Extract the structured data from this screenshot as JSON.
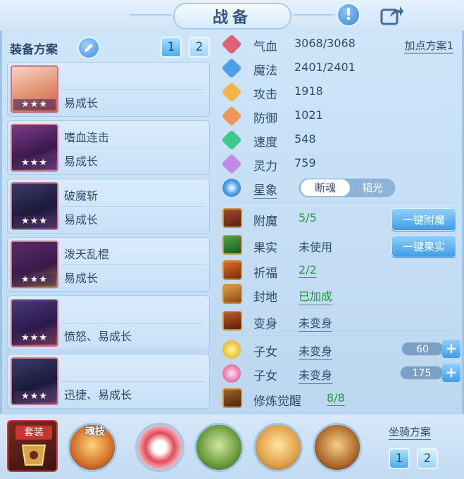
{
  "title": "战备",
  "icons": {
    "info": "exclamation-icon",
    "share": "share-arrow-icon",
    "edit": "pencil-icon"
  },
  "equipment_scheme": {
    "label": "装备方案",
    "tabs": [
      "1",
      "2"
    ],
    "items": [
      {
        "name": "",
        "trait": "易成长",
        "stars": "★★★"
      },
      {
        "name": "嗜血连击",
        "trait": "易成长",
        "stars": "★★★"
      },
      {
        "name": "破魔斩",
        "trait": "易成长",
        "stars": "★★★"
      },
      {
        "name": "泼天乱棍",
        "trait": "易成长",
        "stars": "★★★"
      },
      {
        "name": "",
        "trait": "愤怒、易成长",
        "stars": "★★★"
      },
      {
        "name": "",
        "trait": "迅捷、易成长",
        "stars": "★★★"
      }
    ]
  },
  "attributes": {
    "add_points": "加点方案1",
    "hp": {
      "label": "气血",
      "value": "3068/3068"
    },
    "mp": {
      "label": "魔法",
      "value": "2401/2401"
    },
    "atk": {
      "label": "攻击",
      "value": "1918"
    },
    "def": {
      "label": "防御",
      "value": "1021"
    },
    "spd": {
      "label": "速度",
      "value": "548"
    },
    "spirit": {
      "label": "灵力",
      "value": "759"
    },
    "star": {
      "label": "星象",
      "on": "断魂",
      "off": "韬光"
    }
  },
  "enhance": {
    "enchant": {
      "label": "附魔",
      "value": "5/5",
      "button": "一键附魔"
    },
    "fruit": {
      "label": "果实",
      "value": "未使用",
      "button": "一键果实"
    },
    "blessing": {
      "label": "祈福",
      "value": "2/2"
    },
    "seal": {
      "label": "封地",
      "value": "已加成"
    },
    "transform": {
      "label": "变身",
      "value": "未变身"
    },
    "child1": {
      "label": "子女",
      "value": "未变身",
      "bar": "60"
    },
    "child2": {
      "label": "子女",
      "value": "未变身",
      "bar": "175"
    },
    "awaken": {
      "label": "修炼觉醒",
      "value": "8/8"
    }
  },
  "bottom": {
    "set_label": "套装",
    "soul_label": "魂技",
    "mount_label": "坐骑方案",
    "mount_tabs": [
      "1",
      "2"
    ]
  },
  "colors": {
    "accent": "#3f9de8",
    "green": "#1f9a3a",
    "panel": "#c8e0f7"
  }
}
